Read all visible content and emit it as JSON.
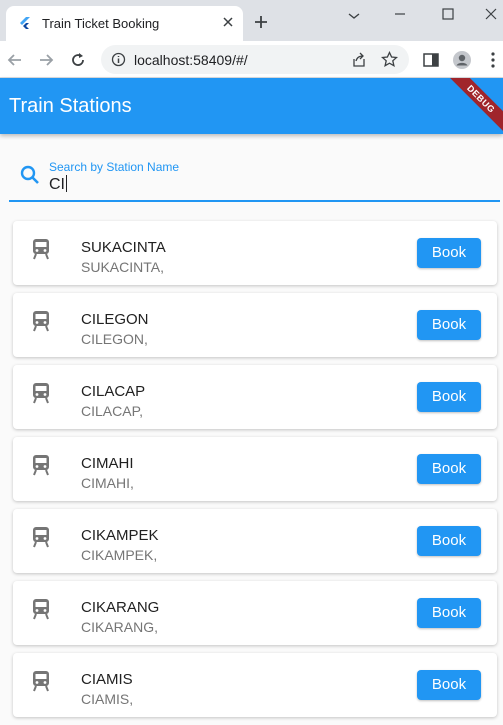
{
  "browser": {
    "tab_title": "Train Ticket Booking",
    "url": "localhost:58409/#/"
  },
  "app": {
    "title": "Train Stations",
    "debug_banner": "DEBUG"
  },
  "search": {
    "label": "Search by Station Name",
    "value": "CI"
  },
  "stations": [
    {
      "name": "SUKACINTA",
      "subtitle": "SUKACINTA,",
      "action": "Book"
    },
    {
      "name": "CILEGON",
      "subtitle": "CILEGON,",
      "action": "Book"
    },
    {
      "name": "CILACAP",
      "subtitle": "CILACAP,",
      "action": "Book"
    },
    {
      "name": "CIMAHI",
      "subtitle": "CIMAHI,",
      "action": "Book"
    },
    {
      "name": "CIKAMPEK",
      "subtitle": "CIKAMPEK,",
      "action": "Book"
    },
    {
      "name": "CIKARANG",
      "subtitle": "CIKARANG,",
      "action": "Book"
    },
    {
      "name": "CIAMIS",
      "subtitle": "CIAMIS,",
      "action": "Book"
    }
  ],
  "colors": {
    "primary": "#2196f3",
    "debug": "#a0252b",
    "icon_grey": "#757575"
  },
  "icons": {
    "station": "train-icon",
    "search": "search-icon"
  }
}
